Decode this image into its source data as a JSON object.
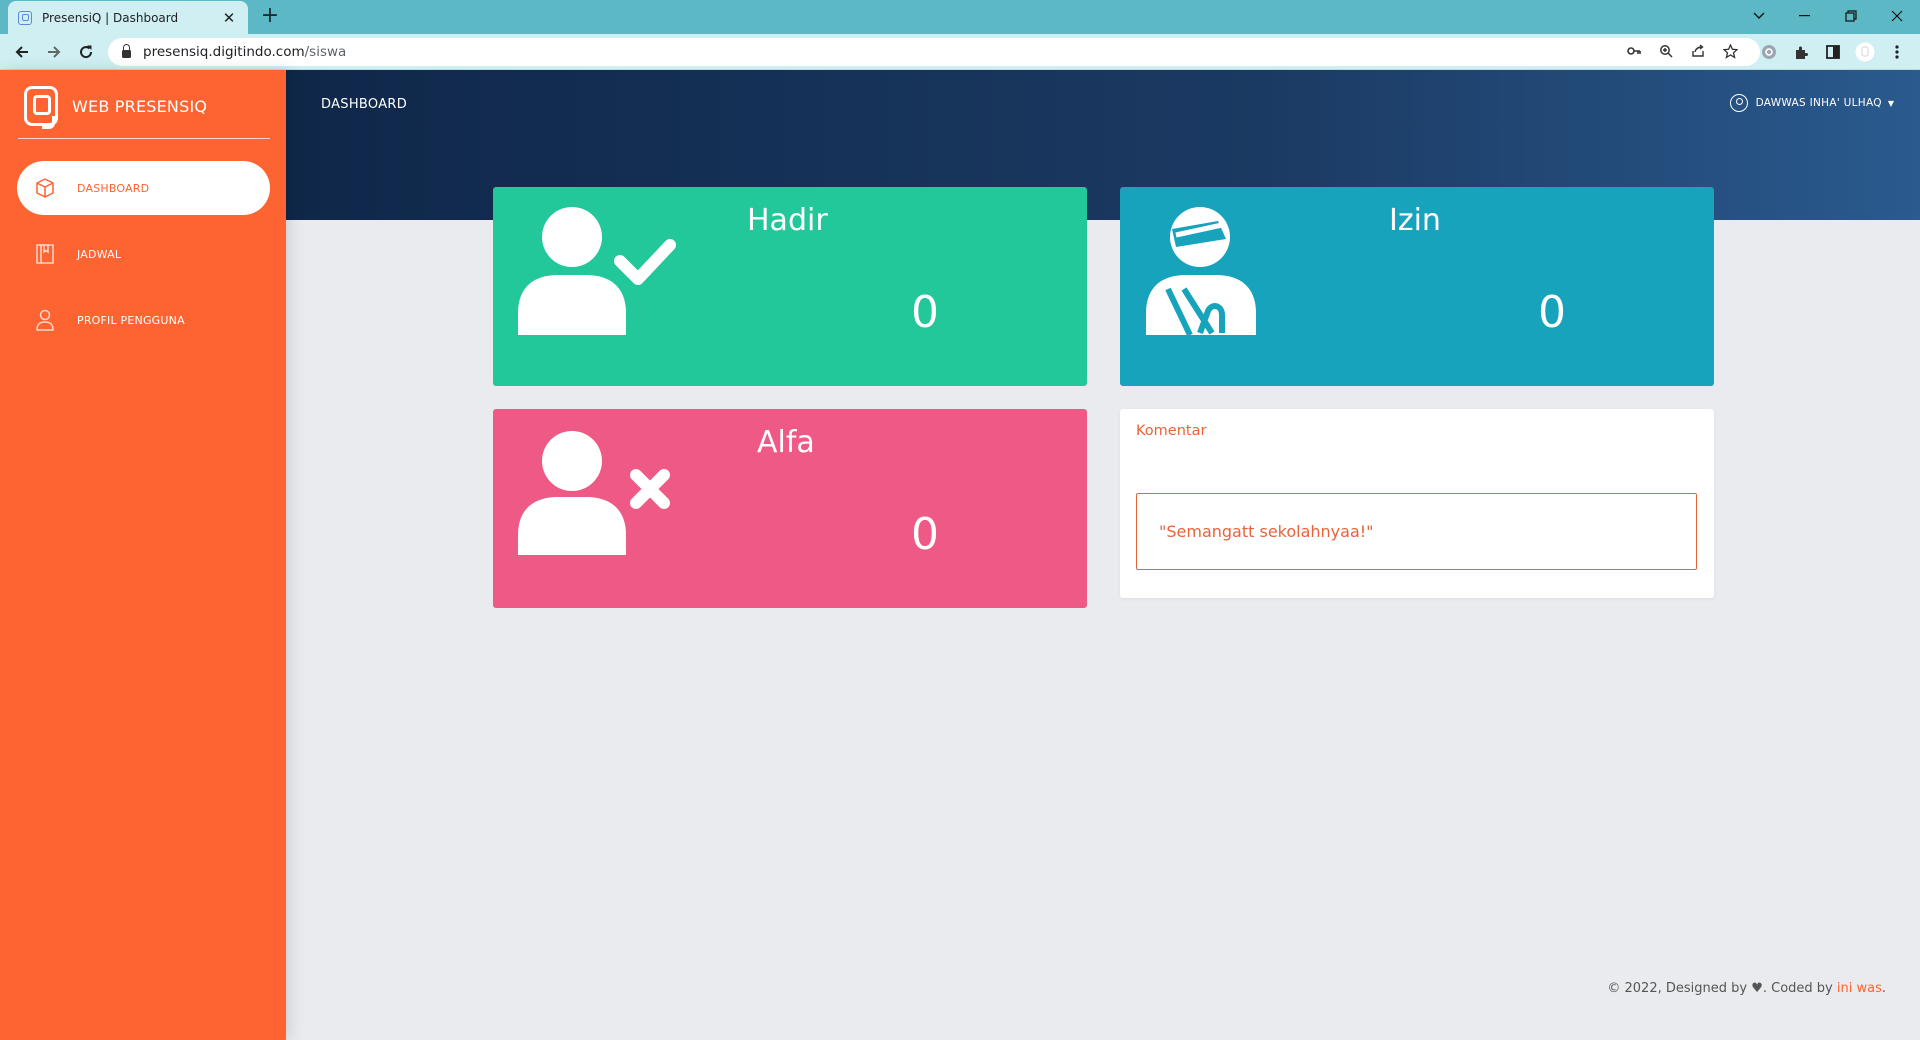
{
  "browser": {
    "tab_title": "PresensiQ | Dashboard",
    "tab_close": "✕",
    "new_tab": "+",
    "url_host": "presensiq.digitindo.com",
    "url_path": "/siswa"
  },
  "sidebar": {
    "brand": "WEB PRESENSIQ",
    "items": [
      {
        "label": "DASHBOARD",
        "icon": "box-icon",
        "active": true
      },
      {
        "label": "JADWAL",
        "icon": "book-icon",
        "active": false
      },
      {
        "label": "PROFIL PENGGUNA",
        "icon": "user-icon",
        "active": false
      }
    ]
  },
  "header": {
    "title": "DASHBOARD",
    "user_name": "DAWWAS INHA' ULHAQ"
  },
  "cards": {
    "hadir": {
      "title": "Hadir",
      "count": "0",
      "color": "#22c89a",
      "icon": "user-check-icon"
    },
    "izin": {
      "title": "Izin",
      "count": "0",
      "color": "#18a3bd",
      "icon": "injured-person-icon"
    },
    "alfa": {
      "title": "Alfa",
      "count": "0",
      "color": "#ee5a85",
      "icon": "user-x-icon"
    }
  },
  "comment": {
    "title": "Komentar",
    "text": "\"Semangatt sekolahnyaa!\""
  },
  "footer": {
    "prefix": "© 2022, Designed by",
    "mid": ". Coded by",
    "author": "ini was",
    "suffix": "."
  },
  "colors": {
    "sidebar": "#fd6431",
    "header_start": "#0f2749",
    "header_end": "#2a5a8e",
    "background": "#e9ebef"
  }
}
